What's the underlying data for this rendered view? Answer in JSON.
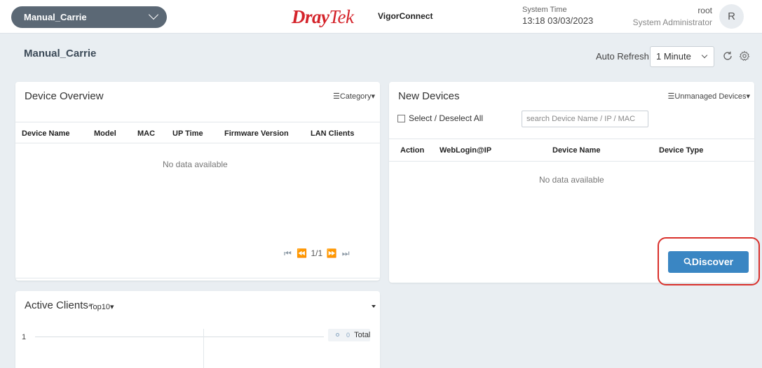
{
  "header": {
    "site": "Manual_Carrie",
    "brand_dray": "Dray",
    "brand_tek": "Tek",
    "product": "VigorConnect",
    "system_time_label": "System Time",
    "system_time_value": "13:18 03/03/2023",
    "user_name": "root",
    "user_role": "System Administrator",
    "avatar_letter": "R"
  },
  "page": {
    "title": "Manual_Carrie",
    "auto_refresh_label": "Auto Refresh:",
    "auto_refresh_value": "1 Minute"
  },
  "device_overview": {
    "title": "Device Overview",
    "menu": "☰Category▾",
    "columns": [
      "Device Name",
      "Model",
      "MAC",
      "UP Time",
      "Firmware Version",
      "LAN Clients"
    ],
    "empty": "No data available",
    "pager": "1/1"
  },
  "new_devices": {
    "title": "New Devices",
    "menu": "☰Unmanaged Devices▾",
    "select_all": "Select / Deselect All",
    "search_placeholder": "search Device Name / IP / MAC",
    "columns": [
      "Action",
      "WebLogin@IP",
      "Device Name",
      "Device Type"
    ],
    "empty": "No data available",
    "discover": "Discover"
  },
  "active_clients": {
    "title": "Active Clients-",
    "filter": "Top10▾",
    "y_tick": "1",
    "legend_value": "0",
    "legend_label": "Total"
  },
  "colors": {
    "accent": "#3a86c3",
    "brand_red": "#d4232a",
    "highlight": "#d9302b"
  }
}
